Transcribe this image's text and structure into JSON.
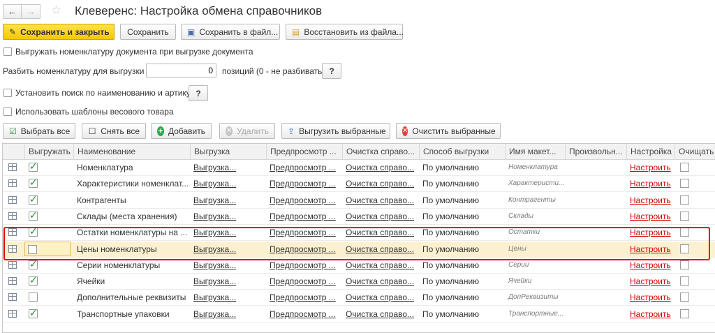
{
  "window": {
    "title": "Клеверенс: Настройка обмена справочников"
  },
  "toolbar": {
    "save_close": "Сохранить и закрыть",
    "save": "Сохранить",
    "save_file": "Сохранить в файл...",
    "restore_file": "Восстановить из файла..."
  },
  "options": {
    "export_doc_items": "Выгружать номенклатуру документа при выгрузке документа",
    "split_label": "Разбить номенклатуру для выгрузки по:",
    "split_value": "0",
    "split_suffix": "позиций (0 - не разбивать)",
    "search_by_name": "Установить поиск по наименованию и артикулу",
    "weight_templates": "Использовать шаблоны весового товара",
    "help": "?"
  },
  "actions": {
    "select_all": "Выбрать все",
    "deselect_all": "Снять все",
    "add": "Добавить",
    "delete": "Удалить",
    "export_selected": "Выгрузить выбранные",
    "clear_selected": "Очистить выбранные"
  },
  "table": {
    "headers": [
      "Выгружать",
      "Наименование",
      "Выгрузка",
      "Предпросмотр ...",
      "Очистка справо...",
      "Способ выгрузки",
      "Имя макет...",
      "Произвольн...",
      "Настройка",
      "Очищать"
    ],
    "rows": [
      {
        "checked": true,
        "name": "Номенклатура",
        "export": "Выгрузка...",
        "preview": "Предпросмотр ...",
        "clear": "Очистка справо...",
        "method": "По умолчанию",
        "layout": "Номенклатура",
        "setting": "Настроить"
      },
      {
        "checked": true,
        "name": "Характеристики номенклат...",
        "export": "Выгрузка...",
        "preview": "Предпросмотр ...",
        "clear": "Очистка справо...",
        "method": "По умолчанию",
        "layout": "Характеристи...",
        "setting": "Настроить"
      },
      {
        "checked": true,
        "name": "Контрагенты",
        "export": "Выгрузка...",
        "preview": "Предпросмотр ...",
        "clear": "Очистка справо...",
        "method": "По умолчанию",
        "layout": "Контрагенты",
        "setting": "Настроить"
      },
      {
        "checked": true,
        "name": "Склады (места хранения)",
        "export": "Выгрузка...",
        "preview": "Предпросмотр ...",
        "clear": "Очистка справо...",
        "method": "По умолчанию",
        "layout": "Склады",
        "setting": "Настроить"
      },
      {
        "checked": true,
        "name": "Остатки номенклатуры на ...",
        "export": "Выгрузка...",
        "preview": "Предпросмотр ...",
        "clear": "Очистка справо...",
        "method": "По умолчанию",
        "layout": "Остатки",
        "setting": "Настроить"
      },
      {
        "checked": false,
        "name": "Цены номенклатуры",
        "export": "Выгрузка...",
        "preview": "Предпросмотр ...",
        "clear": "Очистка справо...",
        "method": "По умолчанию",
        "layout": "Цены",
        "setting": "Настроить"
      },
      {
        "checked": true,
        "name": "Серии номенклатуры",
        "export": "Выгрузка...",
        "preview": "Предпросмотр ...",
        "clear": "Очистка справо...",
        "method": "По умолчанию",
        "layout": "Серии",
        "setting": "Настроить"
      },
      {
        "checked": true,
        "name": "Ячейки",
        "export": "Выгрузка...",
        "preview": "Предпросмотр ...",
        "clear": "Очистка справо...",
        "method": "По умолчанию",
        "layout": "Ячейки",
        "setting": "Настроить"
      },
      {
        "checked": false,
        "name": "Дополнительные реквизиты",
        "export": "Выгрузка...",
        "preview": "Предпросмотр ...",
        "clear": "Очистка справо...",
        "method": "По умолчанию",
        "layout": "ДопРеквизиты",
        "setting": "Настроить"
      },
      {
        "checked": true,
        "name": "Транспортные упаковки",
        "export": "Выгрузка...",
        "preview": "Предпросмотр ...",
        "clear": "Очистка справо...",
        "method": "По умолчанию",
        "layout": "Транспортные...",
        "setting": "Настроить"
      }
    ]
  }
}
